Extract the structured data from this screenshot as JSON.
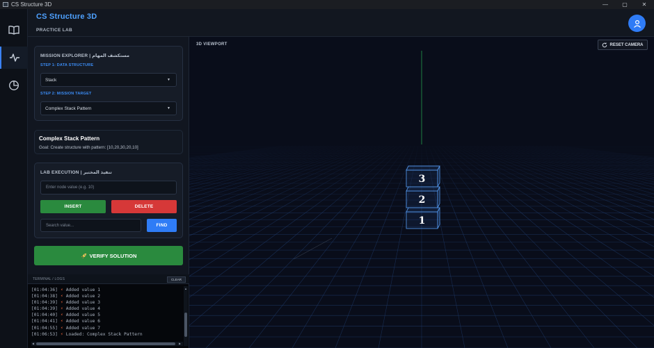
{
  "window": {
    "title": "CS Structure 3D",
    "controls": {
      "minimize": "—",
      "maximize": "▢",
      "close": "✕"
    }
  },
  "rail": {
    "items": [
      {
        "icon": "book-icon"
      },
      {
        "icon": "activity-icon",
        "active": true
      },
      {
        "icon": "pie-chart-icon"
      }
    ]
  },
  "header": {
    "brand": "CS Structure 3D",
    "subtitle": "PRACTICE LAB"
  },
  "mission_explorer": {
    "title": "MISSION EXPLORER | مستكشف المهام",
    "step1_label": "STEP 1: DATA STRUCTURE",
    "step1_value": "Stack",
    "step2_label": "STEP 2: MISSION TARGET",
    "step2_value": "Complex Stack Pattern"
  },
  "mission_card": {
    "title": "Complex Stack Pattern",
    "goal": "Goal: Create structure with pattern: [10,20,30,20,10]"
  },
  "lab_execution": {
    "title": "LAB EXECUTION | تنفيذ المختبر",
    "node_placeholder": "Enter node value (e.g. 10)",
    "insert_label": "INSERT",
    "delete_label": "DELETE",
    "search_placeholder": "Search value...",
    "find_label": "FIND"
  },
  "verify": {
    "icon": "rocket-icon",
    "label": "VERIFY SOLUTION"
  },
  "terminal": {
    "title": "TERMINAL / LOGS",
    "clear_label": "CLEAR",
    "lines": [
      {
        "time": "[01:04:36]",
        "msg": "Added value 1"
      },
      {
        "time": "[01:04:38]",
        "msg": "Added value 2"
      },
      {
        "time": "[01:04:39]",
        "msg": "Added value 3"
      },
      {
        "time": "[01:04:39]",
        "msg": "Added value 4"
      },
      {
        "time": "[01:04:40]",
        "msg": "Added value 5"
      },
      {
        "time": "[01:04:41]",
        "msg": "Added value 6"
      },
      {
        "time": "[01:04:55]",
        "msg": "Added value 7"
      },
      {
        "time": "[01:06:53]",
        "msg": "Loaded: Complex Stack Pattern"
      }
    ]
  },
  "viewport": {
    "label": "3D VIEWPORT",
    "reset_label": "RESET CAMERA",
    "stack": [
      "3",
      "2",
      "1"
    ],
    "colors": {
      "grid": "#1f3b6b",
      "box": "#4f8fe0",
      "axis": "#2fbf5a"
    }
  }
}
